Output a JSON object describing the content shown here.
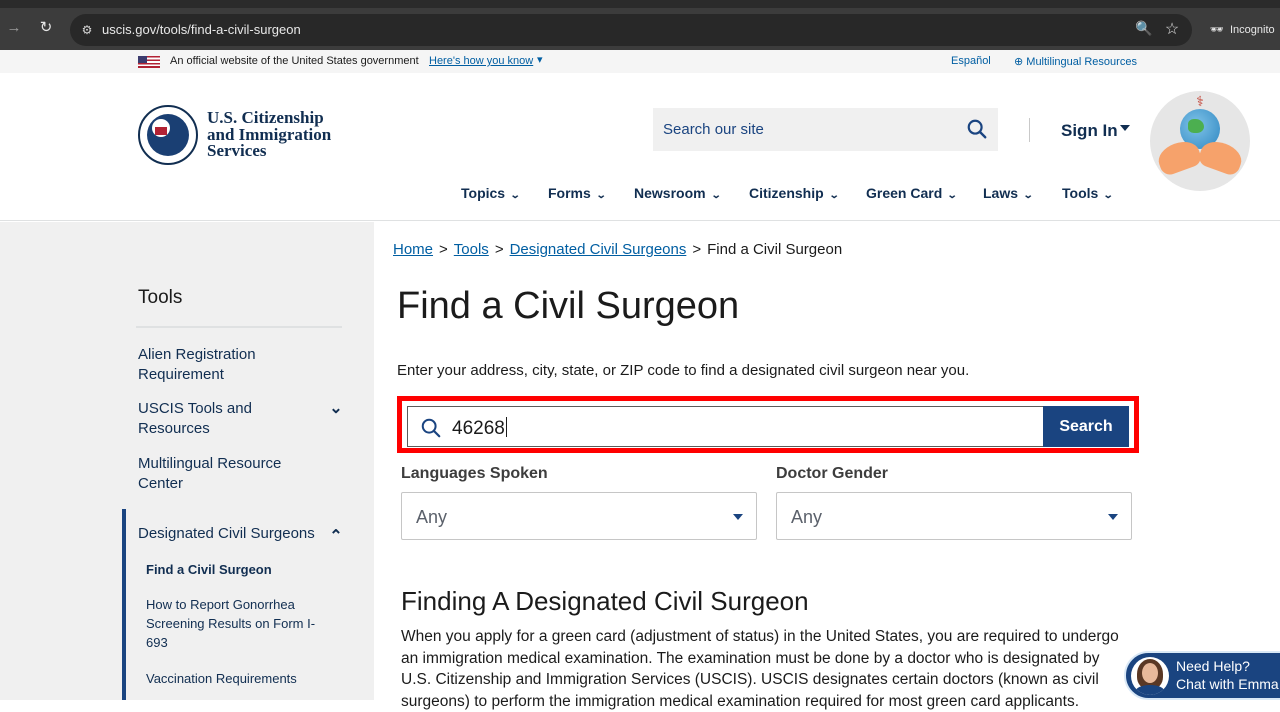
{
  "browser": {
    "url": "uscis.gov/tools/find-a-civil-surgeon",
    "incognito_label": "Incognito"
  },
  "gov_banner": {
    "official_text": "An official website of the United States government",
    "how_know_link": "Here's how you know",
    "espanol_link": "Español",
    "multilingual_link": "Multilingual Resources"
  },
  "header": {
    "agency_line1": "U.S. Citizenship",
    "agency_line2": "and Immigration",
    "agency_line3": "Services",
    "search_placeholder": "Search our site",
    "sign_in": "Sign In"
  },
  "main_nav": [
    "Topics",
    "Forms",
    "Newsroom",
    "Citizenship",
    "Green Card",
    "Laws",
    "Tools"
  ],
  "sidebar": {
    "title": "Tools",
    "items": [
      "Alien Registration Requirement",
      "USCIS Tools and Resources",
      "Multilingual Resource Center",
      "Designated Civil Surgeons"
    ],
    "sub_items": [
      "Find a Civil Surgeon",
      "How to Report Gonorrhea Screening Results on Form I-693",
      "Vaccination Requirements"
    ]
  },
  "breadcrumb": {
    "home": "Home",
    "tools": "Tools",
    "designated": "Designated Civil Surgeons",
    "current": "Find a Civil Surgeon",
    "separator": ">"
  },
  "main": {
    "title": "Find a Civil Surgeon",
    "intro": "Enter your address, city, state, or ZIP code to find a designated civil surgeon near you.",
    "search_value": "46268",
    "search_button": "Search",
    "languages_label": "Languages Spoken",
    "languages_value": "Any",
    "gender_label": "Doctor Gender",
    "gender_value": "Any",
    "section_heading": "Finding A Designated Civil Surgeon",
    "section_body": "When you apply for a green card (adjustment of status) in the United States, you are required to undergo an immigration medical examination. The examination must be done by a doctor who is designated by U.S. Citizenship and Immigration Services (USCIS). USCIS designates certain doctors (known as civil surgeons) to perform the immigration medical examination required for most green card applicants."
  },
  "chat": {
    "line1": "Need Help?",
    "line2": "Chat with Emma"
  },
  "colors": {
    "brand_navy": "#112e51",
    "button_blue": "#1a4480",
    "link_blue": "#005ea2",
    "highlight_red": "#ff0000"
  }
}
